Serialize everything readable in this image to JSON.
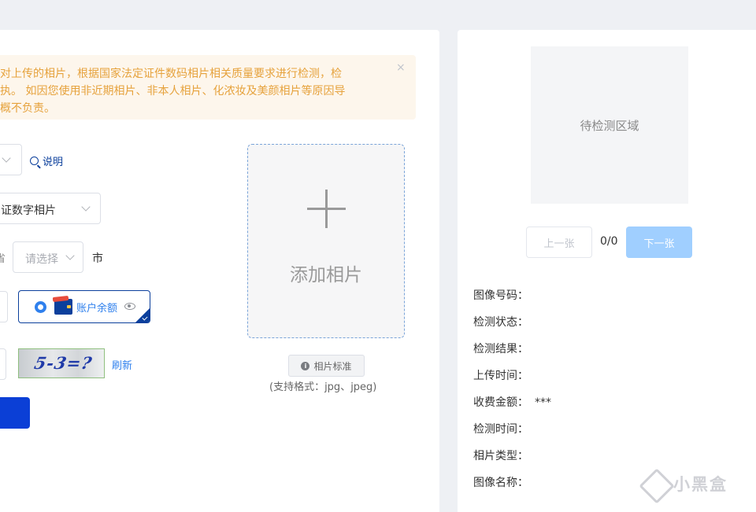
{
  "notice": {
    "line1": "对上传的相片，根据国家法定证件数码相片相关质量要求进行检测，检",
    "line2": "执。 如因您使用非近期相片、非本人相片、化浓妆及美颜相片等原因导",
    "line3": "概不负责。",
    "close": "×"
  },
  "form": {
    "explain_label": "说明",
    "photo_type_value": "证数字相片",
    "province_fragment": "省",
    "city_placeholder": "请选择",
    "city_label": "市",
    "payment_label": "账户余额",
    "captcha_text": "5-3=?",
    "refresh_label": "刷新"
  },
  "upload": {
    "add_label": "添加相片",
    "standard_label": "相片标准",
    "formats": "(支持格式：jpg、jpeg)"
  },
  "preview": {
    "area_label": "待检测区域",
    "prev_label": "上一张",
    "counter": "0/0",
    "next_label": "下一张"
  },
  "info": {
    "rows": [
      {
        "label": "图像号码：",
        "value": ""
      },
      {
        "label": "检测状态：",
        "value": ""
      },
      {
        "label": "检测结果：",
        "value": ""
      },
      {
        "label": "上传时间：",
        "value": ""
      },
      {
        "label": "收费金额：",
        "value": "***"
      },
      {
        "label": "检测时间：",
        "value": ""
      },
      {
        "label": "相片类型：",
        "value": ""
      },
      {
        "label": "图像名称：",
        "value": ""
      }
    ]
  },
  "watermark": {
    "text": "小黑盒"
  },
  "colors": {
    "primary": "#0b3f9c",
    "accent": "#2f80ed",
    "warning": "#e6a23c",
    "disabled_primary": "#a0cfff"
  }
}
